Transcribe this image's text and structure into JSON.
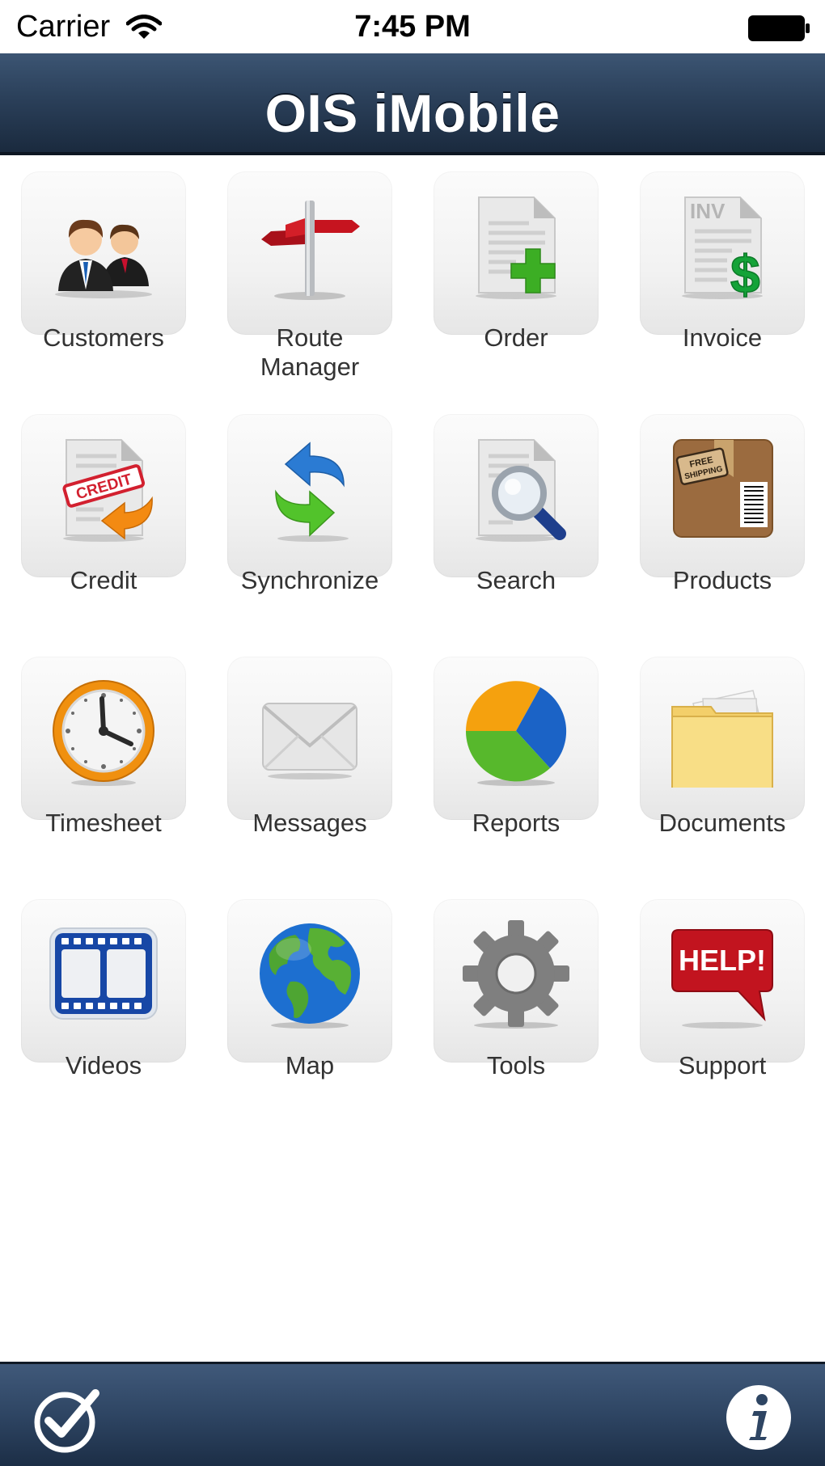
{
  "status_bar": {
    "carrier": "Carrier",
    "time": "7:45 PM"
  },
  "header": {
    "title": "OIS iMobile"
  },
  "tiles": [
    {
      "label": "Customers",
      "icon": "customers-icon"
    },
    {
      "label": "Route\nManager",
      "icon": "signpost-icon"
    },
    {
      "label": "Order",
      "icon": "order-document-icon"
    },
    {
      "label": "Invoice",
      "icon": "invoice-document-icon"
    },
    {
      "label": "Credit",
      "icon": "credit-document-icon"
    },
    {
      "label": "Synchronize",
      "icon": "sync-arrows-icon"
    },
    {
      "label": "Search",
      "icon": "search-document-icon"
    },
    {
      "label": "Products",
      "icon": "shipping-box-icon"
    },
    {
      "label": "Timesheet",
      "icon": "clock-icon"
    },
    {
      "label": "Messages",
      "icon": "envelope-icon"
    },
    {
      "label": "Reports",
      "icon": "pie-chart-icon"
    },
    {
      "label": "Documents",
      "icon": "folder-icon"
    },
    {
      "label": "Videos",
      "icon": "film-strip-icon"
    },
    {
      "label": "Map",
      "icon": "globe-icon"
    },
    {
      "label": "Tools",
      "icon": "gear-icon"
    },
    {
      "label": "Support",
      "icon": "help-bubble-icon"
    }
  ],
  "icon_text": {
    "inv": "INV",
    "dollar": "$",
    "credit": "CREDIT",
    "free": "FREE",
    "shipping": "SHIPPING",
    "help": "HELP!"
  },
  "toolbar": {
    "left_icon": "checkmark-logo-icon",
    "right_icon": "info-icon"
  },
  "colors": {
    "header_top": "#3c5573",
    "header_bottom": "#1a2a3e",
    "label_text": "#333333"
  }
}
